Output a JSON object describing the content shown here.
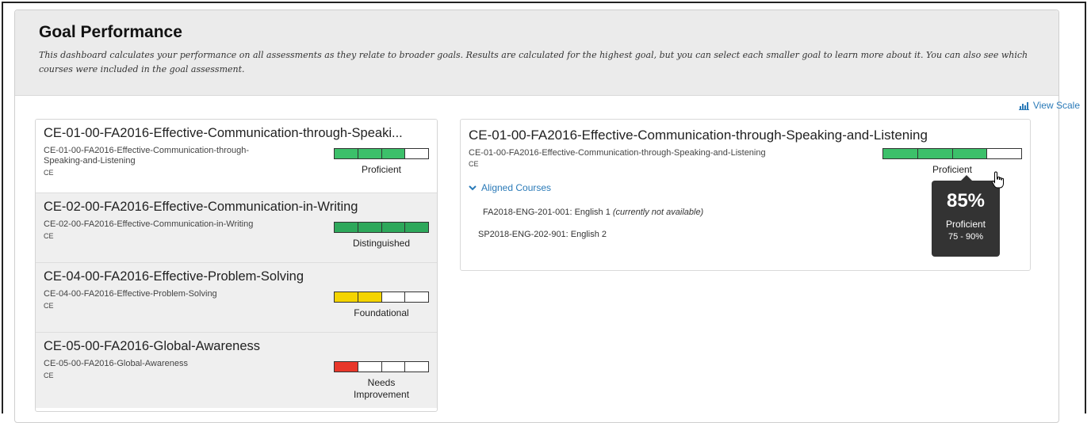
{
  "header": {
    "title": "Goal Performance",
    "description": "This dashboard calculates your performance on all assessments as they relate to broader goals. Results are calculated for the highest goal, but you can select each smaller goal to learn more about it. You can also see which courses were included in the goal assessment."
  },
  "view_scale": {
    "label": "View Scale",
    "icon": "bar-chart-icon"
  },
  "colors": {
    "green": "#3cc06a",
    "dark_green": "#2ea85b",
    "yellow": "#f4d400",
    "red": "#e8372a",
    "link": "#2a7ab8"
  },
  "goals": [
    {
      "title": "CE-01-00-FA2016-Effective-Communication-through-Speaki...",
      "subtitle": "CE-01-00-FA2016-Effective-Communication-through-Speaking-and-Listening",
      "code": "CE",
      "level": "Proficient",
      "filled": 3,
      "total": 4,
      "color": "#3cc06a"
    },
    {
      "title": "CE-02-00-FA2016-Effective-Communication-in-Writing",
      "subtitle": "CE-02-00-FA2016-Effective-Communication-in-Writing",
      "code": "CE",
      "level": "Distinguished",
      "filled": 4,
      "total": 4,
      "color": "#2ea85b"
    },
    {
      "title": "CE-04-00-FA2016-Effective-Problem-Solving",
      "subtitle": "CE-04-00-FA2016-Effective-Problem-Solving",
      "code": "CE",
      "level": "Foundational",
      "filled": 2,
      "total": 4,
      "color": "#f4d400"
    },
    {
      "title": "CE-05-00-FA2016-Global-Awareness",
      "subtitle": "CE-05-00-FA2016-Global-Awareness",
      "code": "CE",
      "level": "Needs Improvement",
      "filled": 1,
      "total": 4,
      "color": "#e8372a"
    }
  ],
  "detail": {
    "title": "CE-01-00-FA2016-Effective-Communication-through-Speaking-and-Listening",
    "subtitle": "CE-01-00-FA2016-Effective-Communication-through-Speaking-and-Listening",
    "code": "CE",
    "level": "Proficient",
    "progress_fraction": 0.75,
    "aligned_label": "Aligned Courses",
    "courses": [
      {
        "name": "FA2018-ENG-201-001: English 1",
        "note": "(currently not available)"
      },
      {
        "name": "SP2018-ENG-202-901: English 2",
        "note": ""
      }
    ]
  },
  "tooltip": {
    "percent": "85%",
    "level": "Proficient",
    "range": "75 - 90%"
  }
}
